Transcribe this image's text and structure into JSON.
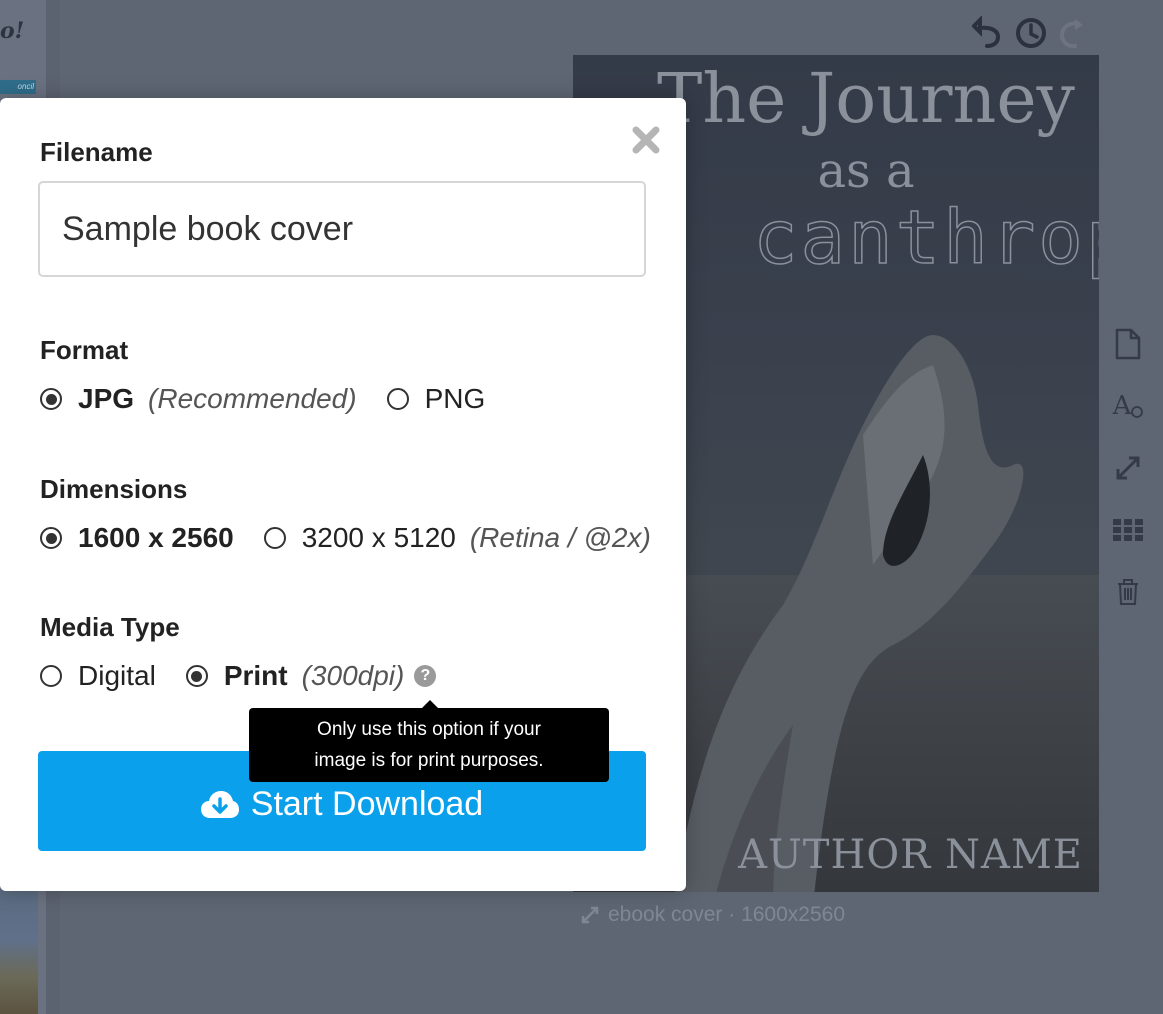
{
  "background": {
    "logo_fragment": "o!",
    "tag_fragment": "oncil",
    "cover": {
      "title_line1": "The Journey",
      "title_line2": "as a",
      "title_line3": "canthrope",
      "author": "AUTHOR NAME"
    },
    "cover_caption": "ebook cover · 1600x2560",
    "side_tool_font_label": "A"
  },
  "modal": {
    "filename": {
      "label": "Filename",
      "value": "Sample book cover"
    },
    "format": {
      "label": "Format",
      "options": [
        {
          "label": "JPG",
          "note": "(Recommended)",
          "selected": true
        },
        {
          "label": "PNG",
          "note": "",
          "selected": false
        }
      ]
    },
    "dimensions": {
      "label": "Dimensions",
      "options": [
        {
          "label": "1600 x 2560",
          "note": "",
          "selected": true
        },
        {
          "label": "3200 x 5120",
          "note": "(Retina / @2x)",
          "selected": false
        }
      ]
    },
    "media_type": {
      "label": "Media Type",
      "options": [
        {
          "label": "Digital",
          "note": "",
          "selected": false
        },
        {
          "label": "Print",
          "note": "(300dpi)",
          "selected": true
        }
      ],
      "help_glyph": "?"
    },
    "tooltip": {
      "line1": "Only use this option if your",
      "line2": "image is for print purposes."
    },
    "download_button": "Start Download"
  },
  "colors": {
    "accent": "#0aa0ec",
    "overlay": "#5e6674",
    "tooltip_bg": "#000000"
  }
}
